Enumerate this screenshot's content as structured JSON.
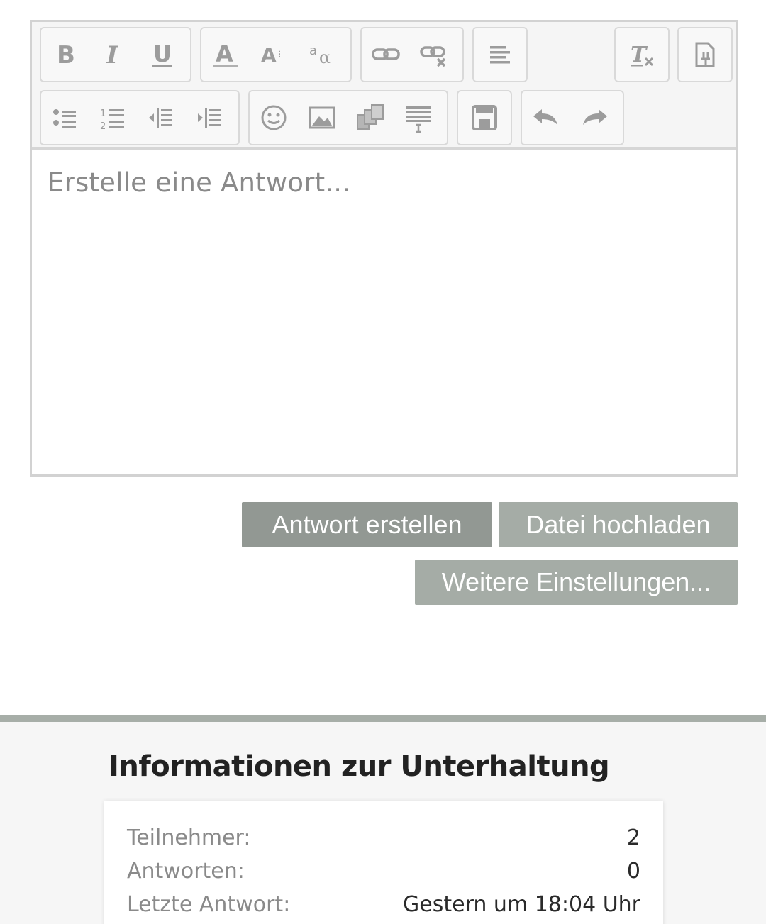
{
  "editor": {
    "placeholder": "Erstelle eine Antwort...",
    "toolbar": {
      "row1": [
        {
          "name": "bold",
          "icon": "bold-icon"
        },
        {
          "name": "italic",
          "icon": "italic-icon"
        },
        {
          "name": "underline",
          "icon": "underline-icon"
        },
        {
          "name": "font-color",
          "icon": "font-color-icon"
        },
        {
          "name": "font-size",
          "icon": "font-size-icon"
        },
        {
          "name": "font-family",
          "icon": "font-family-icon"
        },
        {
          "name": "insert-link",
          "icon": "link-icon"
        },
        {
          "name": "remove-link",
          "icon": "unlink-icon"
        },
        {
          "name": "align",
          "icon": "align-left-icon"
        },
        {
          "name": "clear-format",
          "icon": "clear-format-icon"
        },
        {
          "name": "source",
          "icon": "plugin-icon"
        }
      ],
      "row2": [
        {
          "name": "bullet-list",
          "icon": "bullet-list-icon"
        },
        {
          "name": "numbered-list",
          "icon": "numbered-list-icon"
        },
        {
          "name": "outdent",
          "icon": "outdent-icon"
        },
        {
          "name": "indent",
          "icon": "indent-icon"
        },
        {
          "name": "emoji",
          "icon": "smiley-icon"
        },
        {
          "name": "image",
          "icon": "image-icon"
        },
        {
          "name": "media",
          "icon": "media-icon"
        },
        {
          "name": "table",
          "icon": "table-icon"
        },
        {
          "name": "save",
          "icon": "save-icon"
        },
        {
          "name": "undo",
          "icon": "undo-icon"
        },
        {
          "name": "redo",
          "icon": "redo-icon"
        }
      ]
    }
  },
  "actions": {
    "create_reply": "Antwort erstellen",
    "upload_file": "Datei hochladen",
    "more_settings": "Weitere Einstellungen..."
  },
  "info": {
    "title": "Informationen zur Unterhaltung",
    "rows": [
      {
        "label": "Teilnehmer:",
        "value": "2"
      },
      {
        "label": "Antworten:",
        "value": "0"
      },
      {
        "label": "Letzte Antwort:",
        "value": "Gestern um 18:04 Uhr"
      }
    ]
  },
  "colors": {
    "button_primary": "#929893",
    "button_secondary": "#a5aca6",
    "icon": "#9c9c9c"
  }
}
